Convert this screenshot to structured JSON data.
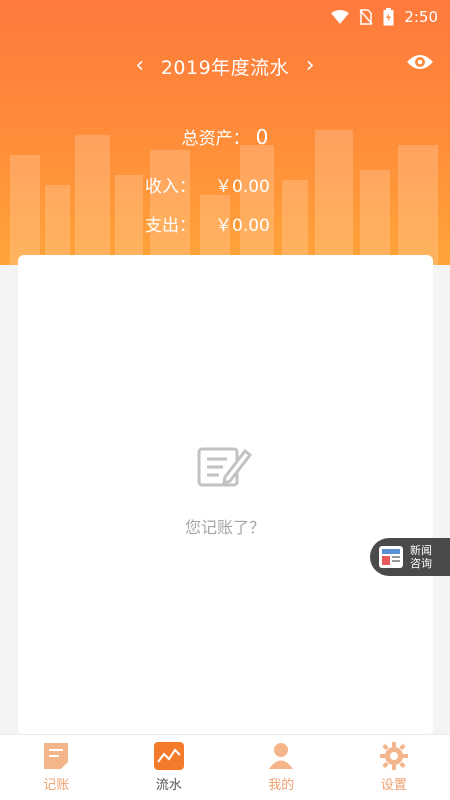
{
  "status_bar": {
    "time": "2:50"
  },
  "header": {
    "year_title": "2019年度流水",
    "prev_arrow": "‹",
    "next_arrow": "›"
  },
  "summary": {
    "total_label": "总资产：",
    "total_value": "0",
    "income_label": "收入：",
    "income_value": "￥0.00",
    "expense_label": "支出：",
    "expense_value": "￥0.00"
  },
  "empty_state": {
    "message": "您记账了？"
  },
  "news_float": {
    "line1": "新闻",
    "line2": "咨询"
  },
  "bottom_nav": {
    "items": [
      {
        "label": "记账",
        "icon": "note-icon"
      },
      {
        "label": "流水",
        "icon": "chart-icon",
        "active": true
      },
      {
        "label": "我的",
        "icon": "person-icon"
      },
      {
        "label": "设置",
        "icon": "gear-icon"
      }
    ]
  },
  "colors": {
    "brand": "#ff7a3c",
    "accent": "#f4a06a"
  }
}
